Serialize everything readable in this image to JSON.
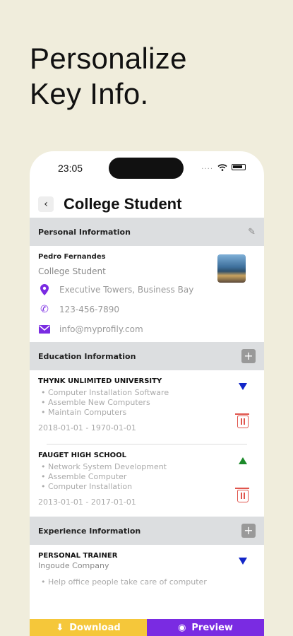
{
  "headline": {
    "line1": "Personalize",
    "line2": "Key Info."
  },
  "status_bar": {
    "time": "23:05",
    "dots": "....",
    "wifi_icon": "wifi-icon",
    "battery_icon": "battery-icon"
  },
  "nav": {
    "back_icon": "chevron-left-icon",
    "title": "College Student"
  },
  "personal": {
    "section_title": "Personal Information",
    "edit_icon": "pencil-icon",
    "name": "Pedro Fernandes",
    "role": "College Student",
    "address": "Executive Towers, Business Bay",
    "phone": "123-456-7890",
    "email": "info@myprofily.com"
  },
  "education": {
    "section_title": "Education Information",
    "add_label": "+",
    "entries": [
      {
        "title": "THYNK UNLIMITED UNIVERSITY",
        "bullets": [
          "Computer Installation Software",
          "Assemble New Computers",
          "Maintain Computers"
        ],
        "dates": "2018-01-01 - 1970-01-01"
      },
      {
        "title": "FAUGET HIGH SCHOOL",
        "bullets": [
          "Network System Development",
          "Assemble Computer",
          "Computer Installation"
        ],
        "dates": "2013-01-01 - 2017-01-01"
      }
    ]
  },
  "experience": {
    "section_title": "Experience Information",
    "add_label": "+",
    "entries": [
      {
        "title": "PERSONAL TRAINER",
        "company": "Ingoude Company",
        "bullets": [
          "Help office people take care of computer"
        ]
      }
    ]
  },
  "actions": {
    "download_label": "Download",
    "preview_label": "Preview"
  },
  "colors": {
    "background": "#f0eddc",
    "accent_purple": "#7a2be2",
    "download_yellow": "#f5c73a",
    "delete_red": "#e0554d",
    "arrow_blue": "#1226c8",
    "arrow_green": "#1c8a2a"
  }
}
